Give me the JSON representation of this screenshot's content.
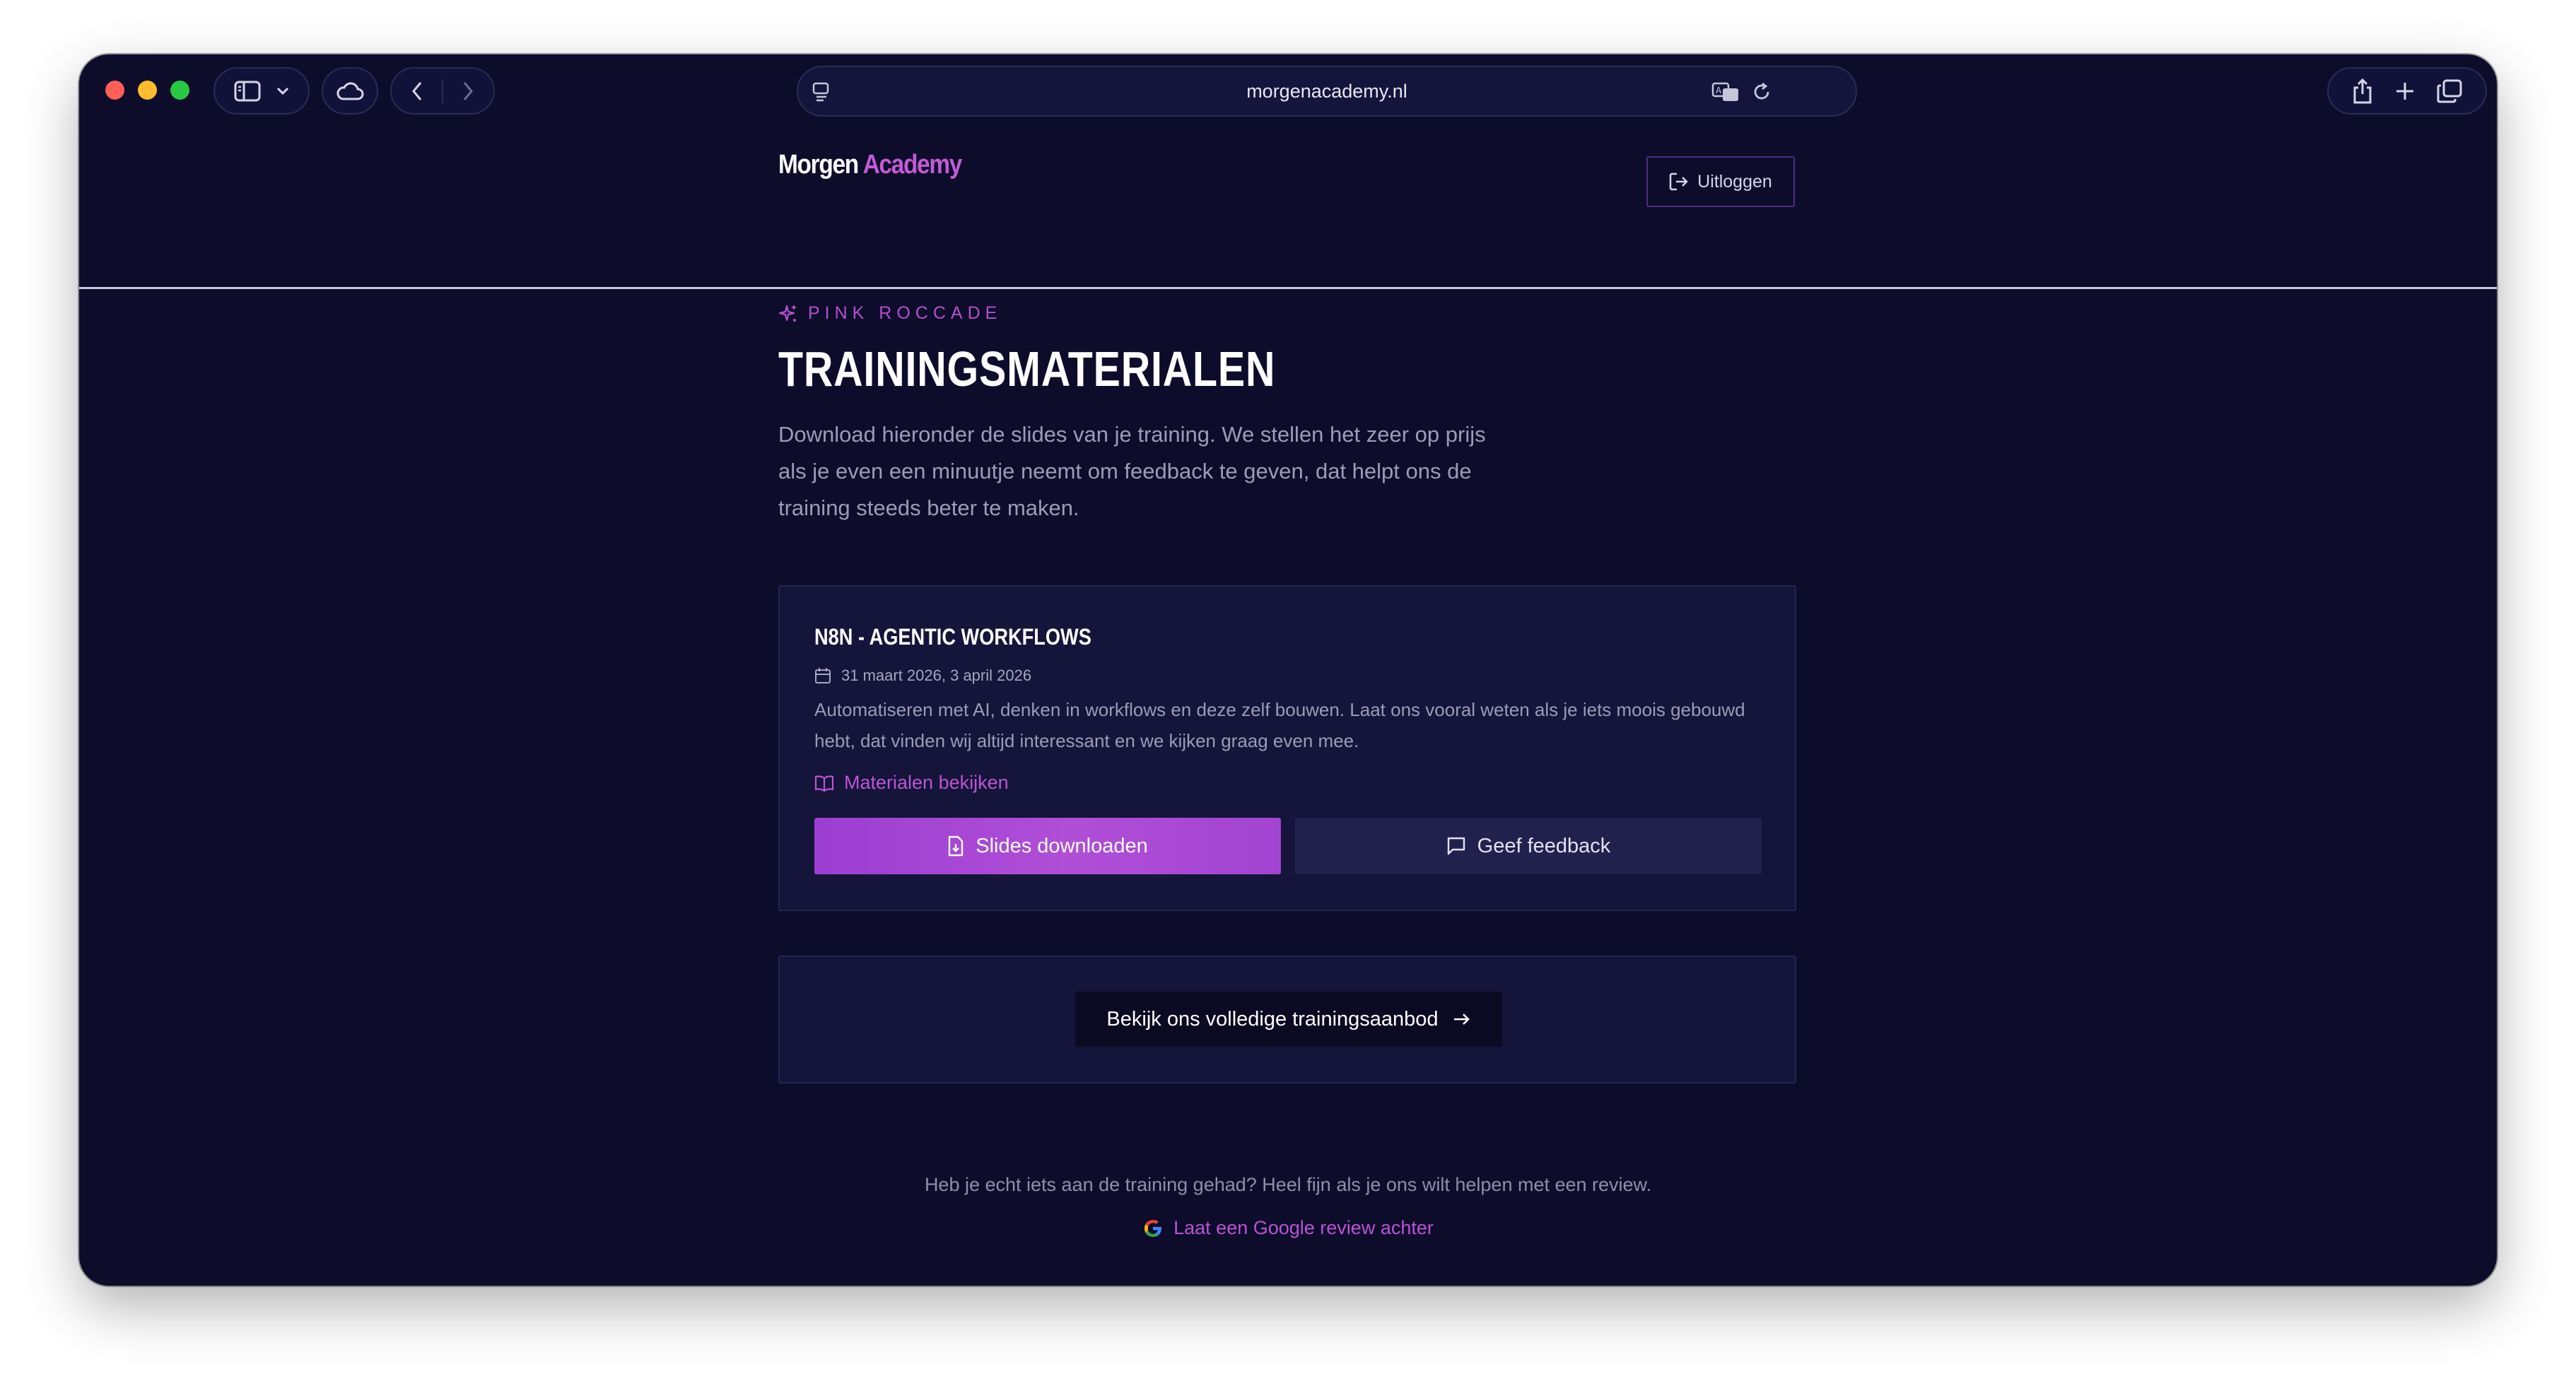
{
  "browser": {
    "url": "morgenacademy.nl"
  },
  "header": {
    "logo_part1": "Morgen",
    "logo_part2": "Academy",
    "logout_label": "Uitloggen"
  },
  "hero": {
    "eyebrow": "PINK ROCCADE",
    "title": "TRAININGSMATERIALEN",
    "intro": "Download hieronder de slides van je training. We stellen het zeer op prijs als je even een minuutje neemt om feedback te geven, dat helpt ons de training steeds beter te maken."
  },
  "training": {
    "title": "N8N - AGENTIC WORKFLOWS",
    "dates": "31 maart 2026, 3 april 2026",
    "description": "Automatiseren met AI, denken in workflows en deze zelf bouwen. Laat ons vooral weten als je iets moois gebouwd hebt, dat vinden wij altijd interessant en we kijken graag even mee.",
    "materials_link": "Materialen bekijken",
    "download_label": "Slides downloaden",
    "feedback_label": "Geef feedback"
  },
  "cta": {
    "label": "Bekijk ons volledige trainingsaanbod"
  },
  "footer": {
    "text": "Heb je echt iets aan de training gehad? Heel fijn als je ons wilt helpen met een review.",
    "review_link": "Laat een Google review achter"
  },
  "colors": {
    "background": "#0d0c2b",
    "card": "#15143a",
    "accent": "#b44fcd",
    "primary_button": "#a547d4"
  }
}
